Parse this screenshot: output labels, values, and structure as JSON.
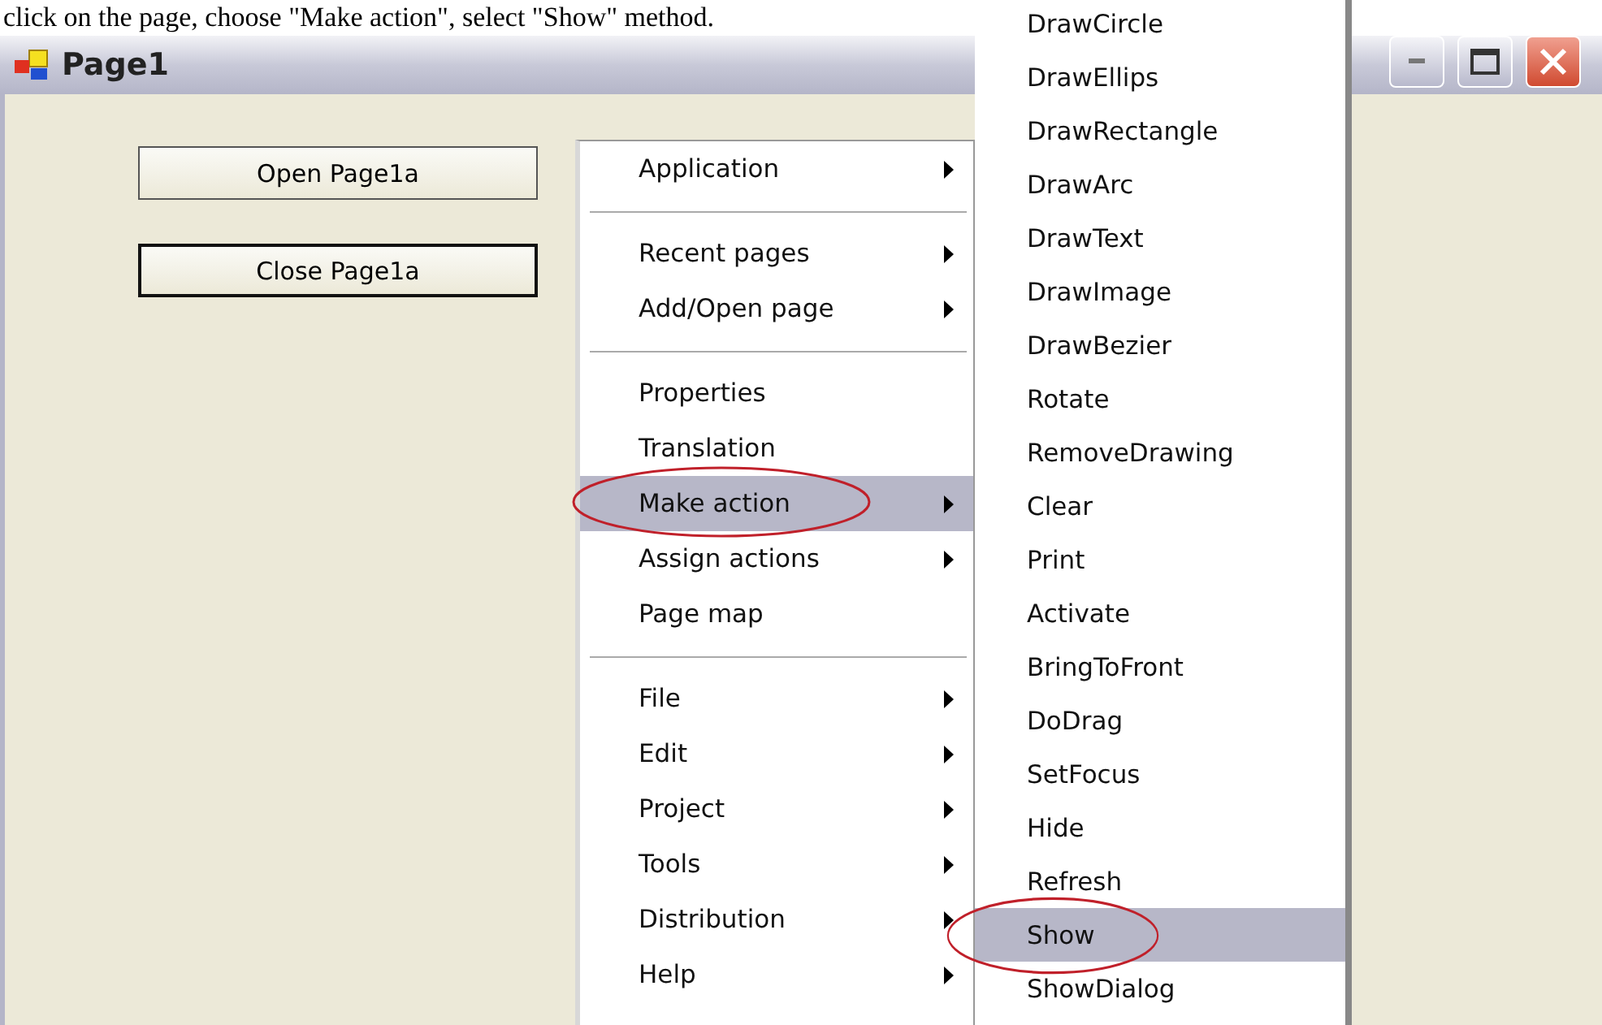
{
  "caption": "click on the page, choose \"Make action\", select \"Show\" method.",
  "window": {
    "title": "Page1"
  },
  "buttons": [
    {
      "label": "Open Page1a",
      "focused": false
    },
    {
      "label": "Close Page1a",
      "focused": true
    }
  ],
  "context_menu": {
    "items": [
      {
        "kind": "item",
        "label": "Application",
        "submenu": true,
        "selected": false,
        "circled": false
      },
      {
        "kind": "separator"
      },
      {
        "kind": "item",
        "label": "Recent pages",
        "submenu": true,
        "selected": false,
        "circled": false
      },
      {
        "kind": "item",
        "label": "Add/Open page",
        "submenu": true,
        "selected": false,
        "circled": false
      },
      {
        "kind": "separator"
      },
      {
        "kind": "item",
        "label": "Properties",
        "submenu": false,
        "selected": false,
        "circled": false
      },
      {
        "kind": "item",
        "label": "Translation",
        "submenu": false,
        "selected": false,
        "circled": false
      },
      {
        "kind": "item",
        "label": "Make action",
        "submenu": true,
        "selected": true,
        "circled": true
      },
      {
        "kind": "item",
        "label": "Assign actions",
        "submenu": true,
        "selected": false,
        "circled": false
      },
      {
        "kind": "item",
        "label": "Page map",
        "submenu": false,
        "selected": false,
        "circled": false
      },
      {
        "kind": "separator"
      },
      {
        "kind": "item",
        "label": "File",
        "submenu": true,
        "selected": false,
        "circled": false
      },
      {
        "kind": "item",
        "label": "Edit",
        "submenu": true,
        "selected": false,
        "circled": false
      },
      {
        "kind": "item",
        "label": "Project",
        "submenu": true,
        "selected": false,
        "circled": false
      },
      {
        "kind": "item",
        "label": "Tools",
        "submenu": true,
        "selected": false,
        "circled": false
      },
      {
        "kind": "item",
        "label": "Distribution",
        "submenu": true,
        "selected": false,
        "circled": false
      },
      {
        "kind": "item",
        "label": "Help",
        "submenu": true,
        "selected": false,
        "circled": false
      }
    ]
  },
  "submenu": {
    "items": [
      {
        "label": "DrawCircle",
        "selected": false,
        "circled": false
      },
      {
        "label": "DrawEllips",
        "selected": false,
        "circled": false
      },
      {
        "label": "DrawRectangle",
        "selected": false,
        "circled": false
      },
      {
        "label": "DrawArc",
        "selected": false,
        "circled": false
      },
      {
        "label": "DrawText",
        "selected": false,
        "circled": false
      },
      {
        "label": "DrawImage",
        "selected": false,
        "circled": false
      },
      {
        "label": "DrawBezier",
        "selected": false,
        "circled": false
      },
      {
        "label": "Rotate",
        "selected": false,
        "circled": false
      },
      {
        "label": "RemoveDrawing",
        "selected": false,
        "circled": false
      },
      {
        "label": "Clear",
        "selected": false,
        "circled": false
      },
      {
        "label": "Print",
        "selected": false,
        "circled": false
      },
      {
        "label": "Activate",
        "selected": false,
        "circled": false
      },
      {
        "label": "BringToFront",
        "selected": false,
        "circled": false
      },
      {
        "label": "DoDrag",
        "selected": false,
        "circled": false
      },
      {
        "label": "SetFocus",
        "selected": false,
        "circled": false
      },
      {
        "label": "Hide",
        "selected": false,
        "circled": false
      },
      {
        "label": "Refresh",
        "selected": false,
        "circled": false
      },
      {
        "label": "Show",
        "selected": true,
        "circled": true
      },
      {
        "label": "ShowDialog",
        "selected": false,
        "circled": false
      }
    ]
  }
}
